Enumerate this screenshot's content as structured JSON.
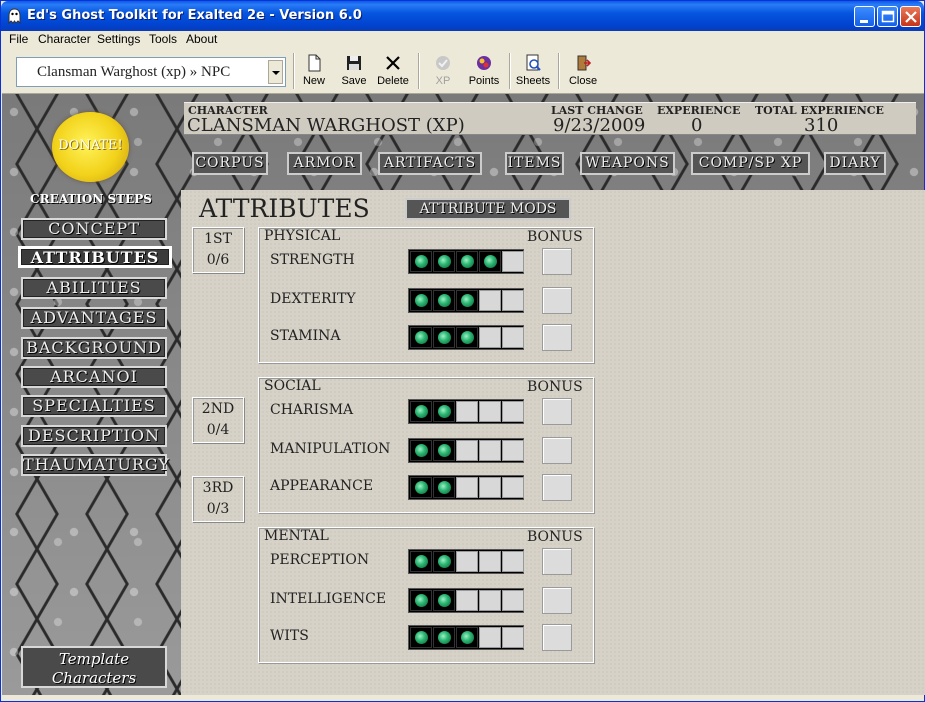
{
  "window": {
    "title": "Ed's Ghost Toolkit for Exalted 2e - Version 6.0"
  },
  "menu": [
    "File",
    "Character",
    "Settings",
    "Tools",
    "About"
  ],
  "toolbar": {
    "character_select": "Clansman Warghost (xp) » NPC",
    "buttons": [
      {
        "label": "New",
        "icon": "new-file-icon",
        "enabled": true
      },
      {
        "label": "Save",
        "icon": "floppy-disk-icon",
        "enabled": true
      },
      {
        "label": "Delete",
        "icon": "delete-x-icon",
        "enabled": true
      },
      {
        "label": "XP",
        "icon": "xp-icon",
        "enabled": false
      },
      {
        "label": "Points",
        "icon": "points-icon",
        "enabled": true
      },
      {
        "label": "Sheets",
        "icon": "sheets-icon",
        "enabled": true
      },
      {
        "label": "Close",
        "icon": "exit-door-icon",
        "enabled": true
      }
    ]
  },
  "sidebar": {
    "donate": "DONATE!",
    "creation_steps_title": "CREATION STEPS",
    "steps": [
      "CONCEPT",
      "ATTRIBUTES",
      "ABILITIES",
      "ADVANTAGES",
      "BACKGROUND",
      "ARCANOI",
      "SPECIALTIES",
      "DESCRIPTION",
      "THAUMATURGY"
    ],
    "active_step": "ATTRIBUTES",
    "template_button": [
      "Template",
      "Characters"
    ]
  },
  "header": {
    "character_label": "CHARACTER",
    "character_name": "CLANSMAN WARGHOST (XP)",
    "last_change_label": "LAST CHANGE",
    "last_change": "9/23/2009",
    "experience_label": "EXPERIENCE",
    "experience": "0",
    "total_experience_label": "TOTAL EXPERIENCE",
    "total_experience": "310"
  },
  "tabs": [
    "CORPUS",
    "ARMOR",
    "ARTIFACTS",
    "ITEMS",
    "WEAPONS",
    "COMP/SP XP",
    "DIARY"
  ],
  "attributes": {
    "title": "ATTRIBUTES",
    "mods_button": "ATTRIBUTE MODS",
    "priorities": [
      {
        "label": "1ST",
        "value": "0/6"
      },
      {
        "label": "2ND",
        "value": "0/4"
      },
      {
        "label": "3RD",
        "value": "0/3"
      }
    ],
    "bonus_label": "BONUS",
    "groups": [
      {
        "name": "PHYSICAL",
        "attrs": [
          {
            "name": "STRENGTH",
            "dots": 4
          },
          {
            "name": "DEXTERITY",
            "dots": 3
          },
          {
            "name": "STAMINA",
            "dots": 3
          }
        ]
      },
      {
        "name": "SOCIAL",
        "attrs": [
          {
            "name": "CHARISMA",
            "dots": 2
          },
          {
            "name": "MANIPULATION",
            "dots": 2
          },
          {
            "name": "APPEARANCE",
            "dots": 2
          }
        ]
      },
      {
        "name": "MENTAL",
        "attrs": [
          {
            "name": "PERCEPTION",
            "dots": 2
          },
          {
            "name": "INTELLIGENCE",
            "dots": 2
          },
          {
            "name": "WITS",
            "dots": 3
          }
        ]
      }
    ],
    "max_dots": 5
  }
}
